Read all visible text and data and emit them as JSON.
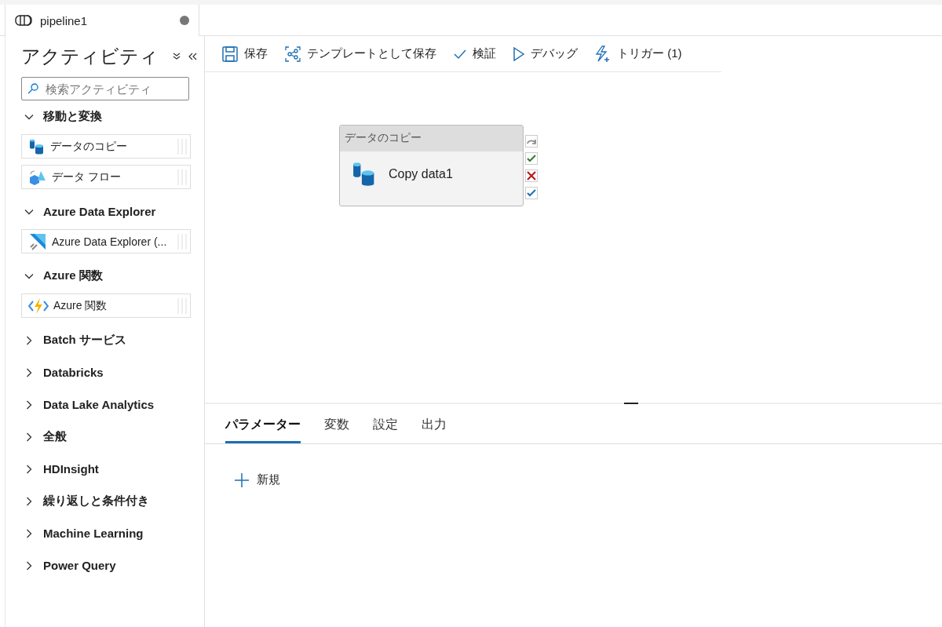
{
  "tab": {
    "title": "pipeline1",
    "unsaved": true
  },
  "sidebar": {
    "title": "アクティビティ",
    "search": {
      "placeholder": "検索アクティビティ"
    },
    "categories": [
      {
        "label": "移動と変換",
        "expanded": true,
        "items": [
          {
            "label": "データのコピー",
            "kind": "copy"
          },
          {
            "label": "データ フロー",
            "kind": "dataflow"
          }
        ]
      },
      {
        "label": "Azure Data Explorer",
        "expanded": true,
        "items": [
          {
            "label": "Azure Data Explorer (...",
            "kind": "adx"
          }
        ]
      },
      {
        "label": "Azure 関数",
        "expanded": true,
        "items": [
          {
            "label": "Azure 関数",
            "kind": "function"
          }
        ]
      },
      {
        "label": "Batch サービス",
        "expanded": false
      },
      {
        "label": "Databricks",
        "expanded": false
      },
      {
        "label": "Data Lake Analytics",
        "expanded": false
      },
      {
        "label": "全般",
        "expanded": false
      },
      {
        "label": "HDInsight",
        "expanded": false
      },
      {
        "label": "繰り返しと条件付き",
        "expanded": false
      },
      {
        "label": "Machine Learning",
        "expanded": false
      },
      {
        "label": "Power Query",
        "expanded": false
      }
    ]
  },
  "toolbar": [
    {
      "label": "保存",
      "kind": "save"
    },
    {
      "label": "テンプレートとして保存",
      "kind": "template"
    },
    {
      "label": "検証",
      "kind": "validate"
    },
    {
      "label": "デバッグ",
      "kind": "debug"
    },
    {
      "label": "トリガー (1)",
      "kind": "trigger"
    }
  ],
  "node": {
    "type": "データのコピー",
    "name": "Copy data1"
  },
  "panel": {
    "tabs": [
      {
        "label": "パラメーター",
        "selected": true
      },
      {
        "label": "変数",
        "selected": false
      },
      {
        "label": "設定",
        "selected": false
      },
      {
        "label": "出力",
        "selected": false
      }
    ],
    "new_button": "新規"
  }
}
